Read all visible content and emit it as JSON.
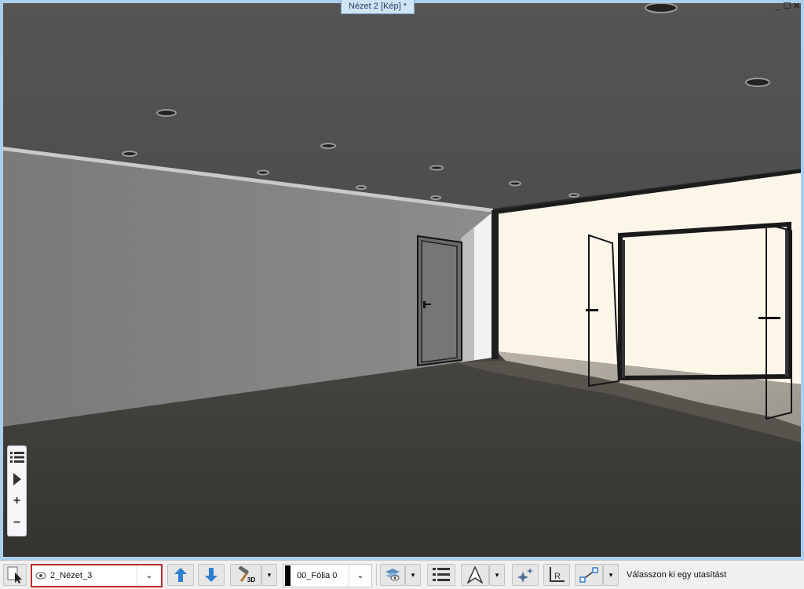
{
  "window": {
    "title": "Nézet 2 [Kép] *",
    "minimize": "_",
    "maximize": "☐",
    "close": "✕"
  },
  "side_toolbar": {
    "icons": [
      "list-icon",
      "play-icon",
      "zoom-in-icon",
      "zoom-out-icon"
    ],
    "zoom_in": "+",
    "zoom_out": "−"
  },
  "bottom_toolbar": {
    "view_selector": {
      "value": "2_Nézet_3",
      "icon": "eye-icon"
    },
    "layer_selector": {
      "value": "00_Fólia 0",
      "color": "#000000"
    },
    "build_3d_label": "3D",
    "status": "Válasszon ki egy utasítást"
  },
  "colors": {
    "frame": "#a9cfee",
    "ceiling": "#575757",
    "left_wall": "#838383",
    "right_wall": "#fbf6e8",
    "floor": "#3b3a37",
    "view_selector_border": "#c0282c",
    "arrow_blue": "#2f7fd0"
  }
}
